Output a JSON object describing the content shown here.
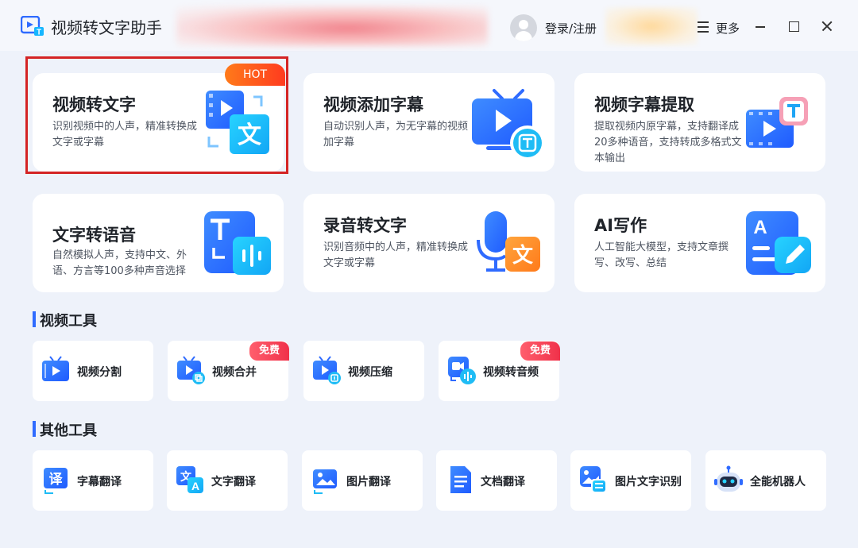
{
  "app": {
    "title": "视频转文字助手",
    "login_label": "登录/注册",
    "more_label": "更多"
  },
  "features": [
    {
      "title": "视频转文字",
      "desc": "识别视频中的人声，精准转换成文字或字幕",
      "badge": "HOT",
      "icon": "video-to-text-icon"
    },
    {
      "title": "视频添加字幕",
      "desc": "自动识别人声，为无字幕的视频加字幕",
      "icon": "tv-subtitle-icon"
    },
    {
      "title": "视频字幕提取",
      "desc": "提取视频内原字幕，支持翻译成20多种语音，支持转成多格式文本输出",
      "icon": "subtitle-extract-icon"
    },
    {
      "title": "文字转语音",
      "desc": "自然模拟人声，支持中文、外语、方言等100多种声音选择",
      "icon": "text-to-speech-icon"
    },
    {
      "title": "录音转文字",
      "desc": "识别音频中的人声，精准转换成文字或字幕",
      "icon": "audio-to-text-icon"
    },
    {
      "title": "AI写作",
      "desc": "人工智能大模型，支持文章撰写、改写、总结",
      "icon": "ai-writing-icon"
    }
  ],
  "sections": {
    "video_tools": "视频工具",
    "other_tools": "其他工具"
  },
  "video_tools": [
    {
      "label": "视频分割",
      "icon": "video-split-icon"
    },
    {
      "label": "视频合并",
      "badge": "免费",
      "icon": "video-merge-icon"
    },
    {
      "label": "视频压缩",
      "icon": "video-compress-icon"
    },
    {
      "label": "视频转音频",
      "badge": "免费",
      "icon": "video-to-audio-icon"
    }
  ],
  "other_tools": [
    {
      "label": "字幕翻译",
      "icon": "subtitle-translate-icon"
    },
    {
      "label": "文字翻译",
      "icon": "text-translate-icon"
    },
    {
      "label": "图片翻译",
      "icon": "image-translate-icon"
    },
    {
      "label": "文档翻译",
      "icon": "document-translate-icon"
    },
    {
      "label": "图片文字识别",
      "icon": "ocr-icon"
    },
    {
      "label": "全能机器人",
      "icon": "robot-icon"
    }
  ],
  "colors": {
    "accent": "#2f6bff",
    "hot": "#ff4a1f",
    "free": "#f0314a",
    "highlight": "#d42424",
    "background": "#eef2fa"
  }
}
